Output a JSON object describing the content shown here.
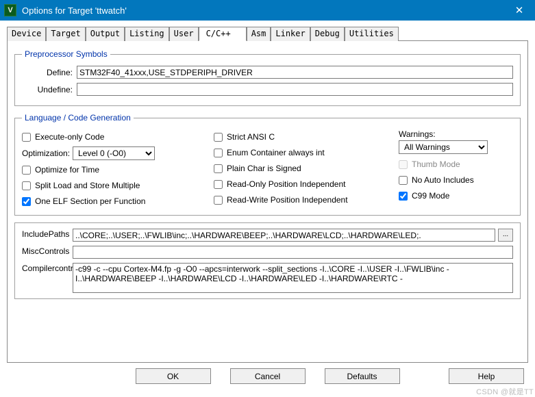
{
  "window": {
    "title": "Options for Target 'ttwatch'",
    "icon_letter": "V",
    "close_glyph": "✕"
  },
  "tabs": [
    "Device",
    "Target",
    "Output",
    "Listing",
    "User",
    "C/C++",
    "Asm",
    "Linker",
    "Debug",
    "Utilities"
  ],
  "active_tab": "C/C++",
  "preprocessor": {
    "legend": "Preprocessor Symbols",
    "define_label": "Define:",
    "define_value": "STM32F40_41xxx,USE_STDPERIPH_DRIVER",
    "undefine_label": "Undefine:",
    "undefine_value": ""
  },
  "langcode": {
    "legend": "Language / Code Generation",
    "execute_only": {
      "label": "Execute-only Code",
      "checked": false
    },
    "optimization_label": "Optimization:",
    "optimization_value": "Level 0 (-O0)",
    "optimize_time": {
      "label": "Optimize for Time",
      "checked": false
    },
    "split_load": {
      "label": "Split Load and Store Multiple",
      "checked": false
    },
    "one_elf": {
      "label": "One ELF Section per Function",
      "checked": true
    },
    "strict_ansi": {
      "label": "Strict ANSI C",
      "checked": false
    },
    "enum_container": {
      "label": "Enum Container always int",
      "checked": false
    },
    "plain_char": {
      "label": "Plain Char is Signed",
      "checked": false
    },
    "ro_pi": {
      "label": "Read-Only Position Independent",
      "checked": false
    },
    "rw_pi": {
      "label": "Read-Write Position Independent",
      "checked": false
    },
    "warnings_label": "Warnings:",
    "warnings_value": "All Warnings",
    "thumb_mode": {
      "label": "Thumb Mode",
      "checked": false,
      "disabled": true
    },
    "no_auto_inc": {
      "label": "No Auto Includes",
      "checked": false
    },
    "c99_mode": {
      "label": "C99 Mode",
      "checked": true
    }
  },
  "include_paths": {
    "label": "Include\nPaths",
    "value": "..\\CORE;..\\USER;..\\FWLIB\\inc;..\\HARDWARE\\BEEP;..\\HARDWARE\\LCD;..\\HARDWARE\\LED;.",
    "browse": "..."
  },
  "misc_controls": {
    "label": "Misc\nControls",
    "value": ""
  },
  "compiler_string": {
    "label": "Compiler\ncontrol\nstring",
    "value": "-c99 -c --cpu Cortex-M4.fp -g -O0 --apcs=interwork --split_sections -I..\\CORE -I..\\USER -I..\\FWLIB\\inc -I..\\HARDWARE\\BEEP -I..\\HARDWARE\\LCD -I..\\HARDWARE\\LED -I..\\HARDWARE\\RTC -"
  },
  "buttons": {
    "ok": "OK",
    "cancel": "Cancel",
    "defaults": "Defaults",
    "help": "Help"
  },
  "watermark": "CSDN @就是TT"
}
